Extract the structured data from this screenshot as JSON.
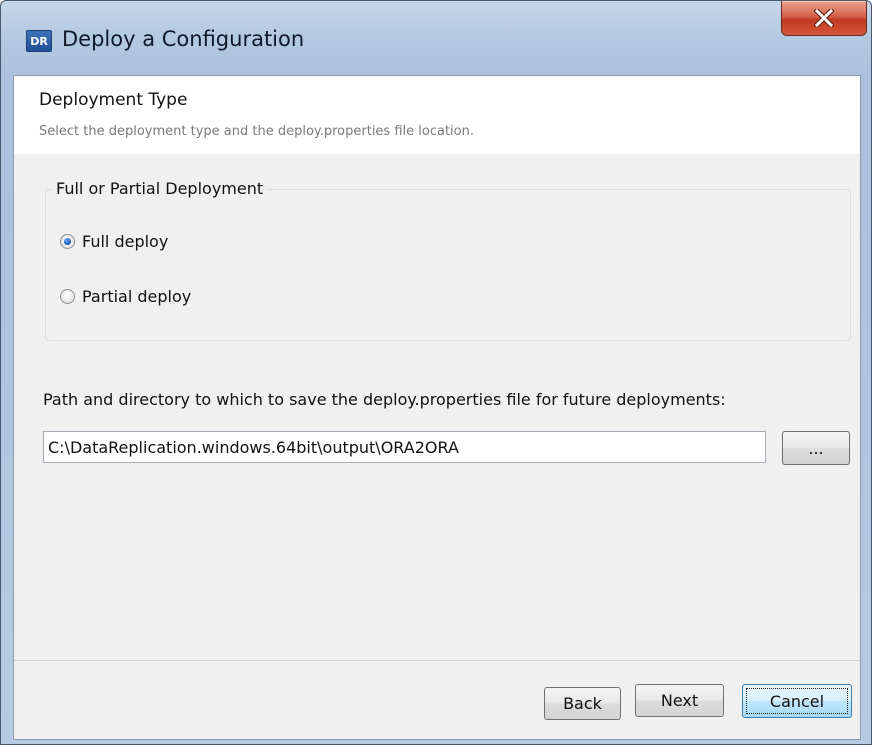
{
  "window": {
    "title": "Deploy a Configuration",
    "app_icon": {
      "label": "DR",
      "icon": "dr-app-icon"
    },
    "close_icon": "close-icon"
  },
  "header": {
    "title": "Deployment Type",
    "subtitle": "Select the deployment type and the deploy.properties file location."
  },
  "deployment_group": {
    "legend": "Full or Partial Deployment",
    "options": [
      {
        "label": "Full deploy",
        "selected": true
      },
      {
        "label": "Partial deploy",
        "selected": false
      }
    ]
  },
  "path": {
    "label": "Path and directory to which to save the deploy.properties file for future deployments:",
    "value": "C:\\DataReplication.windows.64bit\\output\\ORA2ORA",
    "browse_label": "..."
  },
  "footer": {
    "back_label": "Back",
    "next_label": "Next",
    "cancel_label": "Cancel"
  },
  "colors": {
    "title_bar": "#b3c9e1",
    "close_button": "#c23a20",
    "client_bg": "#f0f0f0",
    "radio_selected": "#1a5fb8"
  }
}
